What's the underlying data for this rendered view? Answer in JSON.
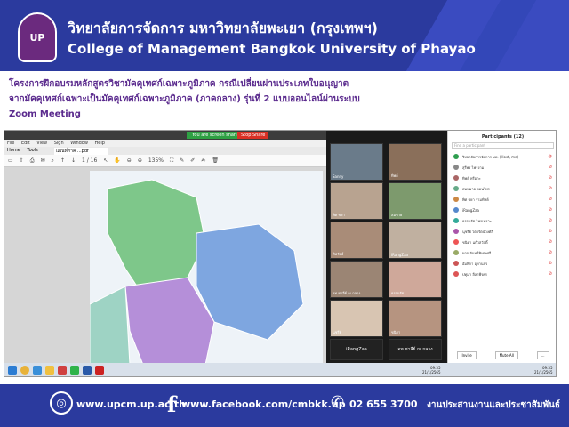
{
  "header": {
    "title_th": "วิทยาลัยการจัดการ มหาวิทยาลัยพะเยา (กรุงเทพฯ)",
    "title_en": "College of Management Bangkok University of Phayao",
    "logo_text": "UP"
  },
  "caption": {
    "line1": "โครงการฝึกอบรมหลักสูตรวิชามัคคุเทศก์เฉพาะภูมิภาค กรณีเปลี่ยนผ่านประเภทใบอนุญาต",
    "line2": "จากมัคคุเทศก์เฉพาะเป็นมัคคุเทศก์เฉพาะภูมิภาค (ภาคกลาง) รุ่นที่ 2 แบบออนไลน์ผ่านระบบ",
    "line3": "Zoom Meeting"
  },
  "screenshot": {
    "zoom_banner": "You are screen sharing",
    "stop_share": "Stop Share",
    "menu": [
      "File",
      "Edit",
      "View",
      "Sign",
      "Window",
      "Help"
    ],
    "pdf_tabs": [
      "Home",
      "Tools"
    ],
    "doc_tab": "แผนที่ภาค ...pdf",
    "page_indicator": "1 / 16",
    "zoom_level": "135%",
    "participants_title": "Participants (12)",
    "search_placeholder": "Find a participant",
    "participants": [
      "วิทยาลัยการจัดการ มพ. (Host, me)",
      "สุรีพร ไพรงาม",
      "ทิพย์ หรือกะ",
      "สมหมาย ดอนไพร",
      "พิศ ชยา รามทิพย์",
      "iRangZaa",
      "ธรรมรัช ไพรเพราะ",
      "นุชรีย์ ไตรรัตน์วงศ์ลี",
      "ชนิดา แก้วสวัสดิ์",
      "ผกก.จันทร์พิเศษศรี",
      "อัมพิกา อุทานจร",
      "ปทุมา ลีลาพีรศร"
    ],
    "video_names": [
      "Sanny",
      "ทิพย์",
      "พิศ ชยา",
      "สมชาย",
      "ทิพวัลย์",
      "iRangZaa",
      "จท ชาลีย์ ณ ถลาง",
      "ธรรมรัช",
      "นุชรีย์",
      "ชนิดา"
    ],
    "namecard_1": "iRangZaa",
    "namecard_2": "จท ชาลีย์ ณ ถลาง",
    "panel_buttons": [
      "Invite",
      "Mute All",
      "..."
    ],
    "clock_left": "09:35\n21/1/2565",
    "clock_right": "09:35\n21/1/2565"
  },
  "footer": {
    "website": "www.upcm.up.ac.th",
    "facebook": "www.facebook.com/cmbkk.up",
    "phone": "02 655 3700",
    "department": "งานประสานงานและประชาสัมพันธ์"
  },
  "colors": {
    "brand_blue": "#2b3a9e",
    "caption_purple": "#5b2b8e",
    "map_green": "#7ec78a",
    "map_blue": "#7ea6e0",
    "map_purple": "#b58fd9"
  }
}
